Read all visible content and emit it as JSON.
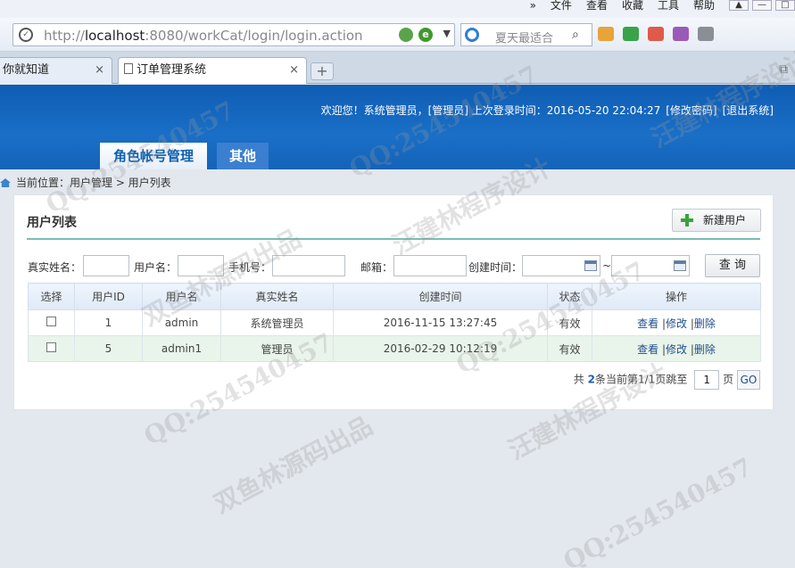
{
  "browser": {
    "menus": [
      "»",
      "文件",
      "查看",
      "收藏",
      "工具",
      "帮助"
    ],
    "url_prefix": "http://",
    "url_host": "localhost",
    "url_rest": ":8080/workCat/login/login.action",
    "search_placeholder": "夏天最适合",
    "tabs": [
      {
        "label": "你就知道"
      },
      {
        "label": "订单管理系统"
      }
    ],
    "new_tab": "+"
  },
  "header": {
    "welcome": "欢迎您！系统管理员，[管理员] 上次登录时间：2016-05-20 22:04:27",
    "change_password": "[修改密码]",
    "logout": "[退出系统]",
    "nav": [
      {
        "label": "角色帐号管理"
      },
      {
        "label": "其他"
      }
    ]
  },
  "breadcrumb": "当前位置：用户管理 > 用户列表",
  "panel": {
    "title": "用户列表",
    "new_button": "新建用户",
    "filters": {
      "real_name_label": "真实姓名：",
      "username_label": "用户名：",
      "phone_label": "手机号：",
      "email_label": "邮箱：",
      "created_label": "创建时间：",
      "range_sep": "~",
      "query_button": "查 询"
    },
    "columns": [
      "选择",
      "用户ID",
      "用户名",
      "真实姓名",
      "创建时间",
      "状态",
      "操作"
    ],
    "rows": [
      {
        "id": "1",
        "username": "admin",
        "real_name": "系统管理员",
        "created": "2016-11-15 13:27:45",
        "status": "有效"
      },
      {
        "id": "5",
        "username": "admin1",
        "real_name": "管理员",
        "created": "2016-02-29 10:12:19",
        "status": "有效"
      }
    ],
    "actions": {
      "view": "查看",
      "edit": "修改",
      "delete": "删除",
      "sep": "|"
    },
    "pager": {
      "prefix": "共",
      "total": "2",
      "suffix": "条当前第1/1页跳至",
      "page_value": "1",
      "page_label": "页",
      "go": "GO"
    }
  },
  "watermarks": [
    "双鱼林源码出品",
    "汪建林程序设计",
    "QQ:254540457"
  ]
}
